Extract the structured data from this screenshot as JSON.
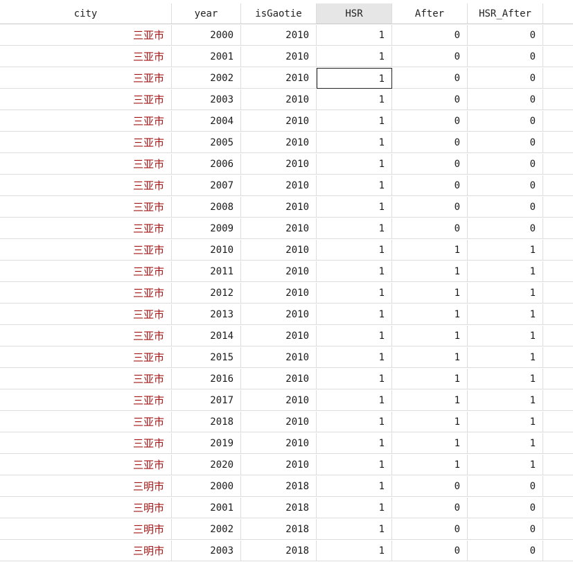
{
  "columns": [
    "city",
    "year",
    "isGaotie",
    "HSR",
    "After",
    "HSR_After"
  ],
  "active_column": "HSR",
  "selected_cell": {
    "row": 2,
    "column": "HSR"
  },
  "rows": [
    {
      "city": "三亚市",
      "year": "2000",
      "isGaotie": "2010",
      "HSR": "1",
      "After": "0",
      "HSR_After": "0"
    },
    {
      "city": "三亚市",
      "year": "2001",
      "isGaotie": "2010",
      "HSR": "1",
      "After": "0",
      "HSR_After": "0"
    },
    {
      "city": "三亚市",
      "year": "2002",
      "isGaotie": "2010",
      "HSR": "1",
      "After": "0",
      "HSR_After": "0"
    },
    {
      "city": "三亚市",
      "year": "2003",
      "isGaotie": "2010",
      "HSR": "1",
      "After": "0",
      "HSR_After": "0"
    },
    {
      "city": "三亚市",
      "year": "2004",
      "isGaotie": "2010",
      "HSR": "1",
      "After": "0",
      "HSR_After": "0"
    },
    {
      "city": "三亚市",
      "year": "2005",
      "isGaotie": "2010",
      "HSR": "1",
      "After": "0",
      "HSR_After": "0"
    },
    {
      "city": "三亚市",
      "year": "2006",
      "isGaotie": "2010",
      "HSR": "1",
      "After": "0",
      "HSR_After": "0"
    },
    {
      "city": "三亚市",
      "year": "2007",
      "isGaotie": "2010",
      "HSR": "1",
      "After": "0",
      "HSR_After": "0"
    },
    {
      "city": "三亚市",
      "year": "2008",
      "isGaotie": "2010",
      "HSR": "1",
      "After": "0",
      "HSR_After": "0"
    },
    {
      "city": "三亚市",
      "year": "2009",
      "isGaotie": "2010",
      "HSR": "1",
      "After": "0",
      "HSR_After": "0"
    },
    {
      "city": "三亚市",
      "year": "2010",
      "isGaotie": "2010",
      "HSR": "1",
      "After": "1",
      "HSR_After": "1"
    },
    {
      "city": "三亚市",
      "year": "2011",
      "isGaotie": "2010",
      "HSR": "1",
      "After": "1",
      "HSR_After": "1"
    },
    {
      "city": "三亚市",
      "year": "2012",
      "isGaotie": "2010",
      "HSR": "1",
      "After": "1",
      "HSR_After": "1"
    },
    {
      "city": "三亚市",
      "year": "2013",
      "isGaotie": "2010",
      "HSR": "1",
      "After": "1",
      "HSR_After": "1"
    },
    {
      "city": "三亚市",
      "year": "2014",
      "isGaotie": "2010",
      "HSR": "1",
      "After": "1",
      "HSR_After": "1"
    },
    {
      "city": "三亚市",
      "year": "2015",
      "isGaotie": "2010",
      "HSR": "1",
      "After": "1",
      "HSR_After": "1"
    },
    {
      "city": "三亚市",
      "year": "2016",
      "isGaotie": "2010",
      "HSR": "1",
      "After": "1",
      "HSR_After": "1"
    },
    {
      "city": "三亚市",
      "year": "2017",
      "isGaotie": "2010",
      "HSR": "1",
      "After": "1",
      "HSR_After": "1"
    },
    {
      "city": "三亚市",
      "year": "2018",
      "isGaotie": "2010",
      "HSR": "1",
      "After": "1",
      "HSR_After": "1"
    },
    {
      "city": "三亚市",
      "year": "2019",
      "isGaotie": "2010",
      "HSR": "1",
      "After": "1",
      "HSR_After": "1"
    },
    {
      "city": "三亚市",
      "year": "2020",
      "isGaotie": "2010",
      "HSR": "1",
      "After": "1",
      "HSR_After": "1"
    },
    {
      "city": "三明市",
      "year": "2000",
      "isGaotie": "2018",
      "HSR": "1",
      "After": "0",
      "HSR_After": "0"
    },
    {
      "city": "三明市",
      "year": "2001",
      "isGaotie": "2018",
      "HSR": "1",
      "After": "0",
      "HSR_After": "0"
    },
    {
      "city": "三明市",
      "year": "2002",
      "isGaotie": "2018",
      "HSR": "1",
      "After": "0",
      "HSR_After": "0"
    },
    {
      "city": "三明市",
      "year": "2003",
      "isGaotie": "2018",
      "HSR": "1",
      "After": "0",
      "HSR_After": "0"
    }
  ]
}
